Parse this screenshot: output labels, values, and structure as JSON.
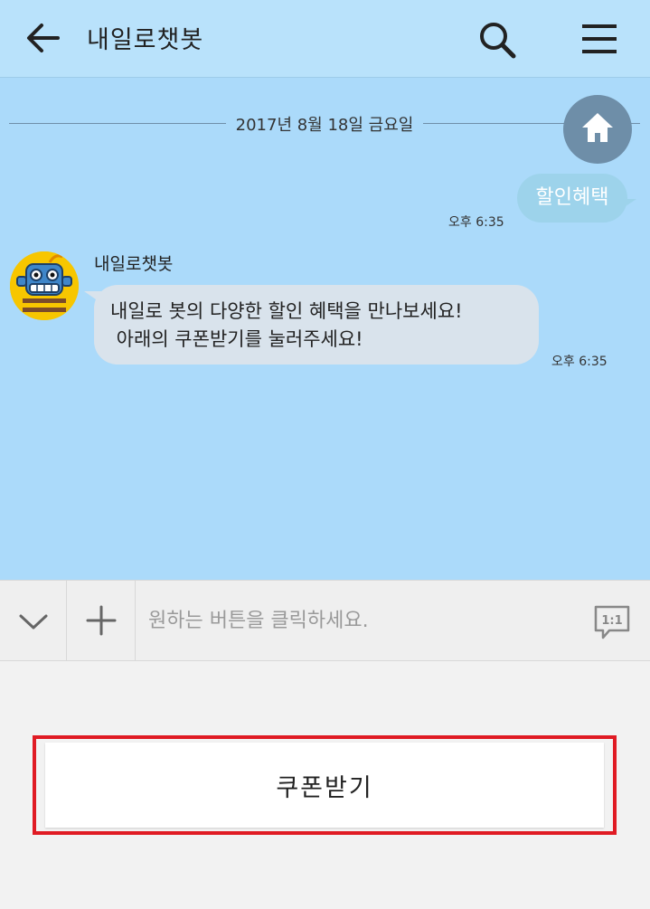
{
  "header": {
    "title": "내일로챗봇",
    "back_icon": "back-arrow-icon",
    "search_icon": "search-icon",
    "menu_icon": "hamburger-menu-icon",
    "background": "#b9e2fb"
  },
  "chat": {
    "background": "#abdafa",
    "date_divider": "2017년 8월 18일 금요일",
    "home_icon": "home-icon",
    "messages": [
      {
        "sender": "user",
        "text": "할인혜택",
        "time": "오후 6:35"
      },
      {
        "sender": "bot",
        "name": "내일로챗봇",
        "lines": [
          "내일로 봇의 다양한 할인 혜택을 만나보세요!",
          " 아래의 쿠폰받기를 눌러주세요!"
        ],
        "time": "오후 6:35"
      }
    ]
  },
  "input_bar": {
    "placeholder": "원하는 버튼을 클릭하세요.",
    "collapse_icon": "chevron-down-icon",
    "plus_icon": "plus-icon",
    "one_to_one_label": "1:1"
  },
  "buttons": {
    "coupon_label": "쿠폰받기",
    "highlight_color": "#e01b24"
  }
}
